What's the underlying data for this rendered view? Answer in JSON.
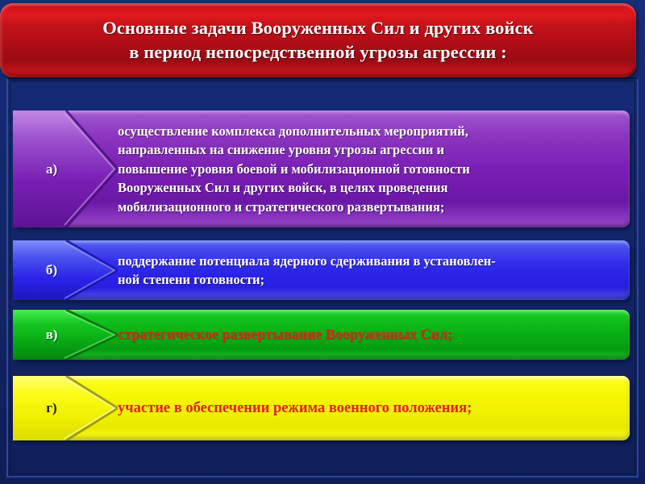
{
  "slide": {
    "title_lines": [
      "Основные задачи Вооруженных Сил и других войск",
      "в период  непосредственной угрозы агрессии :"
    ],
    "background_color": "#13276c",
    "title_color": "#c4121a"
  },
  "items": [
    {
      "label": "а)",
      "color": "#7a1fb4",
      "color_name": "purple",
      "text_color": "#ffffff",
      "lines": [
        "осуществление  комплекса  дополнительных  мероприятий,",
        "направленных  на  снижение  уровня  угрозы  агрессии  и",
        "повышение  уровня  боевой  и  мобилизационной  готовности",
        "Вооруженных  Сил  и  других  войск,  в  целях  проведения",
        "мобилизационного и стратегического  развертывания;"
      ]
    },
    {
      "label": "б)",
      "color": "#2a22e8",
      "color_name": "blue",
      "text_color": "#ffffff",
      "lines": [
        "поддержание потенциала ядерного сдерживания в установлен-",
        "ной степени готовности;"
      ]
    },
    {
      "label": "в)",
      "color": "#07a913",
      "color_name": "green",
      "text_color": "#e2231a",
      "lines": [
        "стратегическое развертывание Вооруженных Сил;"
      ]
    },
    {
      "label": "г)",
      "color": "#efef00",
      "color_name": "yellow",
      "text_color": "#e2231a",
      "lines": [
        "участие в обеспечении режима военного положения;"
      ]
    }
  ]
}
